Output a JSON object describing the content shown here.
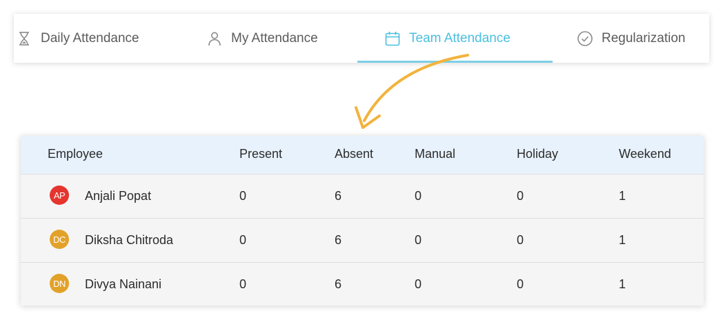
{
  "tabs": [
    {
      "label": "Daily Attendance",
      "icon": "hourglass-icon",
      "active": false
    },
    {
      "label": "My Attendance",
      "icon": "user-icon",
      "active": false
    },
    {
      "label": "Team Attendance",
      "icon": "calendar-icon",
      "active": true
    },
    {
      "label": "Regularization",
      "icon": "check-circle-icon",
      "active": false
    }
  ],
  "colors": {
    "accent": "#4bbfe0",
    "arrow": "#f2b33d",
    "header_bg": "#e8f2fc"
  },
  "table": {
    "columns": [
      "Employee",
      "Present",
      "Absent",
      "Manual",
      "Holiday",
      "Weekend"
    ],
    "rows": [
      {
        "initials": "AP",
        "avatar_color": "#e5352e",
        "name": "Anjali Popat",
        "present": "0",
        "absent": "6",
        "manual": "0",
        "holiday": "0",
        "weekend": "1"
      },
      {
        "initials": "DC",
        "avatar_color": "#e2a229",
        "name": "Diksha Chitroda",
        "present": "0",
        "absent": "6",
        "manual": "0",
        "holiday": "0",
        "weekend": "1"
      },
      {
        "initials": "DN",
        "avatar_color": "#e2a229",
        "name": "Divya Nainani",
        "present": "0",
        "absent": "6",
        "manual": "0",
        "holiday": "0",
        "weekend": "1"
      }
    ]
  }
}
